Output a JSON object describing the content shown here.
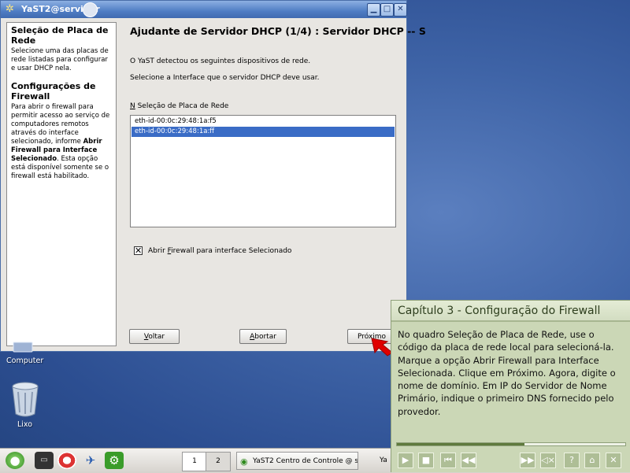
{
  "window": {
    "title": "YaST2@servidor",
    "heading": "Ajudante de Servidor DHCP (1/4) : Servidor DHCP -- S",
    "detected_text": "O YaST detectou os seguintes dispositivos de rede.",
    "select_text": "Selecione a Interface que o servidor DHCP deve usar.",
    "list_label_mnemonic": "N",
    "list_label_rest": " Seleção de Placa de Rede",
    "devices": [
      "eth-id-00:0c:29:48:1a:f5",
      "eth-id-00:0c:29:48:1a:ff"
    ],
    "selected_device_index": 1,
    "firewall_checkbox": {
      "checked": true,
      "label_before": "Abrir ",
      "label_mnemonic": "F",
      "label_after": "irewall para interface Selecionado"
    },
    "buttons": {
      "back_mnemonic": "V",
      "back_rest": "oltar",
      "abort_mnemonic": "A",
      "abort_rest": "bortar",
      "next": "Próximo"
    }
  },
  "help": {
    "sec1_title": "Seleção de Placa de Rede",
    "sec1_text": "Selecione uma das placas de rede listadas para configurar e usar DHCP nela.",
    "sec2_title": "Configurações de Firewall",
    "sec2_text_1": "Para abrir o firewall para permitir acesso ao serviço de computadores remotos através do interface selecionado, informe ",
    "sec2_bold": "Abrir Firewall para Interface Selecionado",
    "sec2_text_2": ". Esta opção está disponível somente se o firewall está habilitado."
  },
  "desktop": {
    "computer_label": "Computer",
    "trash_label": "Lixo"
  },
  "taskbar": {
    "pagers": [
      "1",
      "2"
    ],
    "task1": "YaST2 Centro de Controle @ s",
    "task2": "Ya"
  },
  "tutorial": {
    "title": "Capítulo 3 - Configuração do Firewall",
    "body": "No quadro Seleção de Placa de Rede, use o código da placa de rede local para selecioná-la. Marque a opção Abrir Firewall para Interface Selecionada. Clique em Próximo. Agora, digite o nome de domínio. Em IP do Servidor de Nome Primário, indique o primeiro DNS fornecido pelo provedor.",
    "progress": 0.56
  },
  "colors": {
    "selection": "#3a6cc6",
    "tutorial_bg": "#cbd7b6",
    "pointer_arrow": "#e00000"
  },
  "icons": {
    "window_app": "gear-icon",
    "window_controls": [
      "minimize-icon",
      "maximize-icon",
      "close-icon"
    ],
    "taskbar": [
      "suse-menu-icon",
      "terminal-icon",
      "lifebuoy-icon",
      "network-icon",
      "yast-icon"
    ],
    "tutorial_controls": [
      "play-icon",
      "stop-icon",
      "skip-back-icon",
      "rewind-icon",
      "fast-forward-icon",
      "mute-icon",
      "help-icon",
      "home-icon",
      "close-icon"
    ]
  }
}
